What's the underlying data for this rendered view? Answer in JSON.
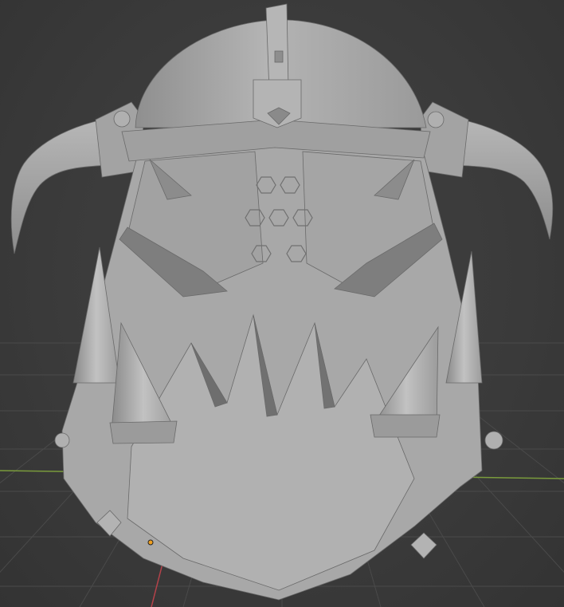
{
  "scene": {
    "subject": "helmet-mesh",
    "colors": {
      "background": "#3a3a3a",
      "grid": "#4a4a4a",
      "x_axis": "#7a9b3c",
      "y_axis": "#b5424a",
      "mesh_base": "#a6a6a6",
      "mesh_light": "#bdbdbd",
      "mesh_shadow": "#6d6d6d",
      "origin": "#f0a020"
    }
  }
}
